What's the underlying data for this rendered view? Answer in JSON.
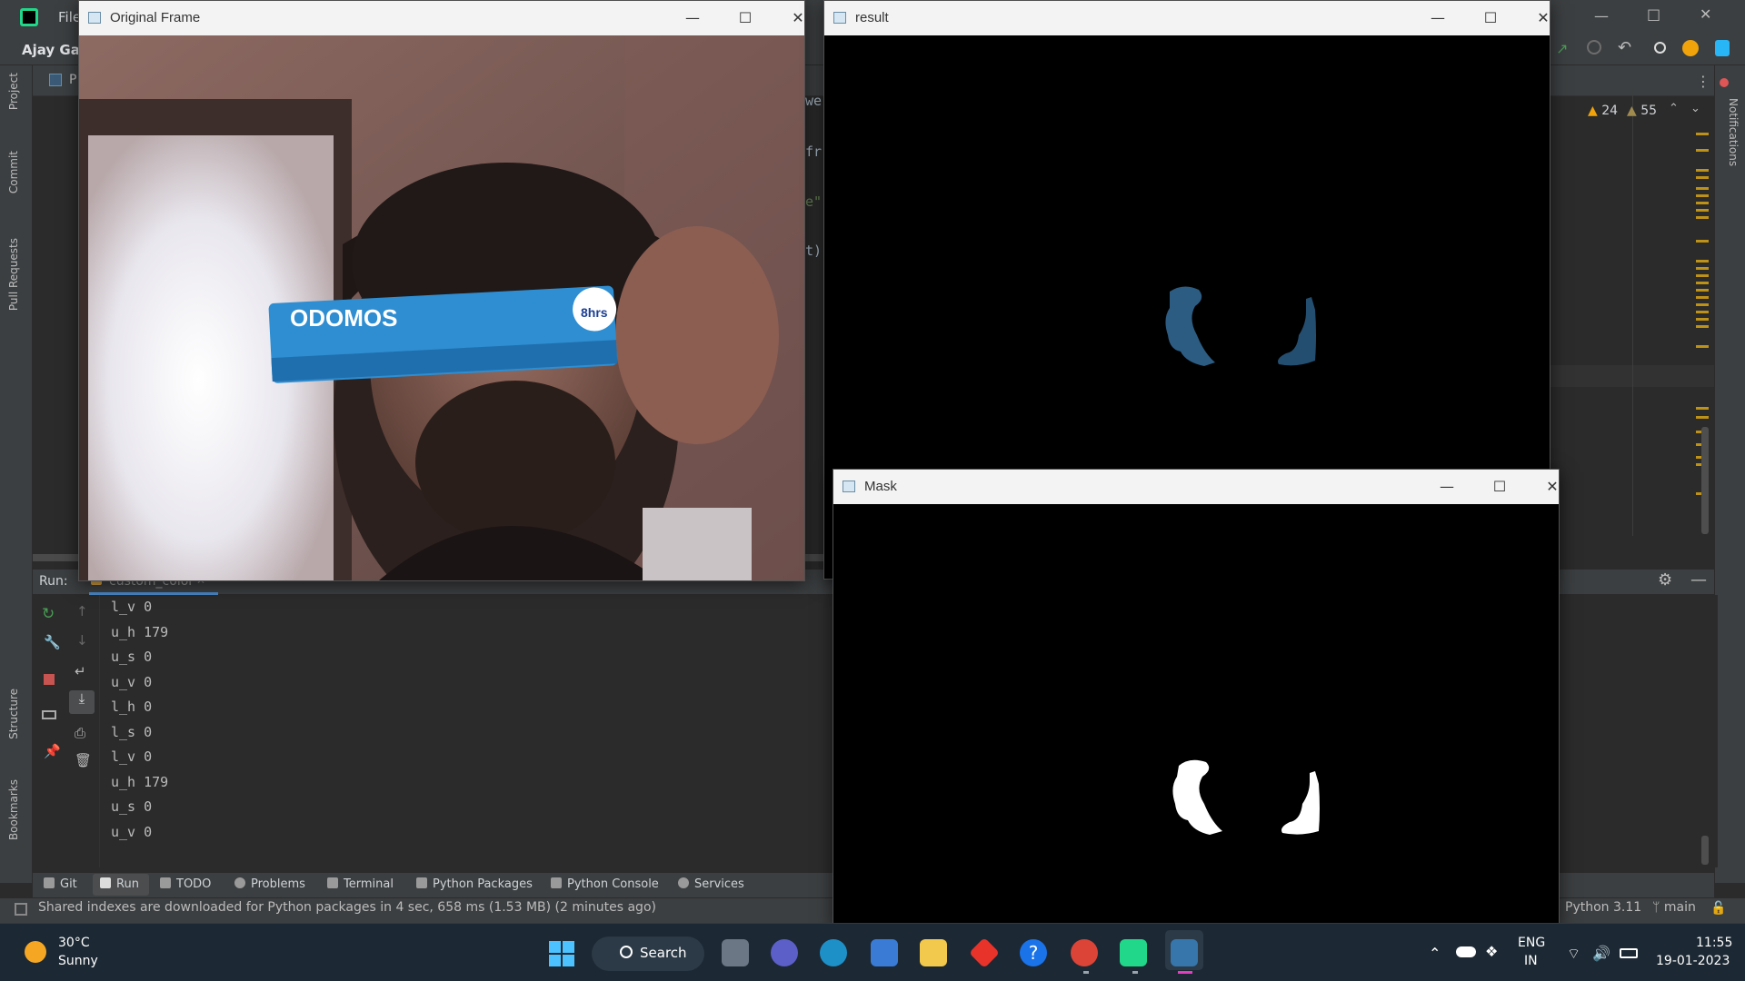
{
  "ide": {
    "menu_file": "File",
    "project_name": "Ajay Gail",
    "project_tab_short": "P",
    "left_tabs": [
      "Project",
      "Commit",
      "Pull Requests",
      "Structure",
      "Bookmarks"
    ],
    "right_tabs": [
      "Notifications"
    ],
    "code_fragments": [
      "we",
      "fr",
      "e\"",
      "t)"
    ],
    "warnings_count": "24",
    "weak_warnings_count": "55",
    "run_label": "Run:",
    "run_tab": "custom_color",
    "console_lines": [
      "l_v 0",
      "u_h 179",
      "u_s 0",
      "u_v 0",
      "l_h 0",
      "l_s 0",
      "l_v 0",
      "u_h 179",
      "u_s 0",
      "u_v 0"
    ],
    "bottom_tabs": [
      "Git",
      "Run",
      "TODO",
      "Problems",
      "Terminal",
      "Python Packages",
      "Python Console",
      "Services"
    ],
    "status_message": "Shared indexes are downloaded for Python packages in 4 sec, 658 ms (1.53 MB) (2 minutes ago)",
    "python_version": "Python 3.11",
    "branch": "main"
  },
  "windows": {
    "original": {
      "title": "Original Frame",
      "product_text": "ODOMOS",
      "badge_text": "8hrs"
    },
    "result": {
      "title": "result"
    },
    "mask": {
      "title": "Mask"
    }
  },
  "taskbar": {
    "weather_temp": "30°C",
    "weather_cond": "Sunny",
    "search_label": "Search",
    "lang_1": "ENG",
    "lang_2": "IN",
    "time": "11:55",
    "date": "19-01-2023"
  },
  "colors": {
    "accent": "#4a88c7",
    "warning": "#be9117",
    "run_green": "#499c54",
    "stop_red": "#c75450"
  }
}
